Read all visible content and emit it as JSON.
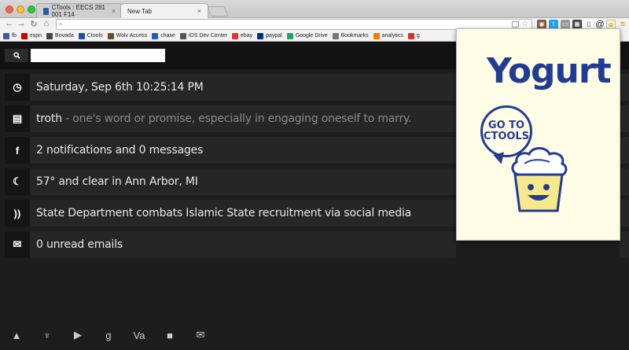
{
  "browser": {
    "tabs": [
      {
        "title": "CTools : EECS 281 001 F14",
        "active": false
      },
      {
        "title": "New Tab",
        "active": true
      }
    ],
    "omnibox": {
      "value": ""
    },
    "bookmarks": [
      {
        "label": "fb",
        "color": "#3b5998"
      },
      {
        "label": "espn",
        "color": "#cc0000"
      },
      {
        "label": "Bovada",
        "color": "#444444"
      },
      {
        "label": "Ctools",
        "color": "#1f4f9c"
      },
      {
        "label": "Wolv Access",
        "color": "#6b4f2b"
      },
      {
        "label": "chase",
        "color": "#1a5fb4"
      },
      {
        "label": "iOS Dev Center",
        "color": "#555555"
      },
      {
        "label": "ebay",
        "color": "#e53238"
      },
      {
        "label": "paypal",
        "color": "#003087"
      },
      {
        "label": "Google Drive",
        "color": "#1fa463"
      },
      {
        "label": "Bookmarks",
        "color": "#777777"
      },
      {
        "label": "analytics",
        "color": "#f57c00"
      },
      {
        "label": "g",
        "color": "#d93025"
      }
    ]
  },
  "search": {
    "placeholder": ""
  },
  "rows": [
    {
      "icon": "clock-icon",
      "glyph": "◷",
      "text": "Saturday, Sep 6th 10:25:14 PM",
      "sub": ""
    },
    {
      "icon": "book-icon",
      "glyph": "▤",
      "text": "troth",
      "sub": " - one's word or promise, especially in engaging oneself to marry."
    },
    {
      "icon": "facebook-icon",
      "glyph": "f",
      "text": "2 notifications and 0 messages",
      "sub": ""
    },
    {
      "icon": "moon-icon",
      "glyph": "☾",
      "text": "57° and clear in Ann Arbor, MI",
      "sub": ""
    },
    {
      "icon": "rss-icon",
      "glyph": "))",
      "text": "State Department combats Islamic State recruitment via social media",
      "sub": ""
    },
    {
      "icon": "mail-icon",
      "glyph": "✉",
      "text": "0 unread emails",
      "sub": ""
    }
  ],
  "dock": [
    {
      "name": "drive-icon",
      "glyph": "▲"
    },
    {
      "name": "umich-icon",
      "glyph": "♆"
    },
    {
      "name": "youtube-icon",
      "glyph": "▶"
    },
    {
      "name": "google-plus-icon",
      "glyph": "g"
    },
    {
      "name": "va-icon",
      "glyph": "Va"
    },
    {
      "name": "app-icon",
      "glyph": "■"
    },
    {
      "name": "gmail-icon",
      "glyph": "✉"
    }
  ],
  "popup": {
    "logo": "Yogurt",
    "bubble_line1": "GO TO",
    "bubble_line2": "CTOOLS",
    "brand_color": "#213c95",
    "bg_color": "#fffde6"
  }
}
